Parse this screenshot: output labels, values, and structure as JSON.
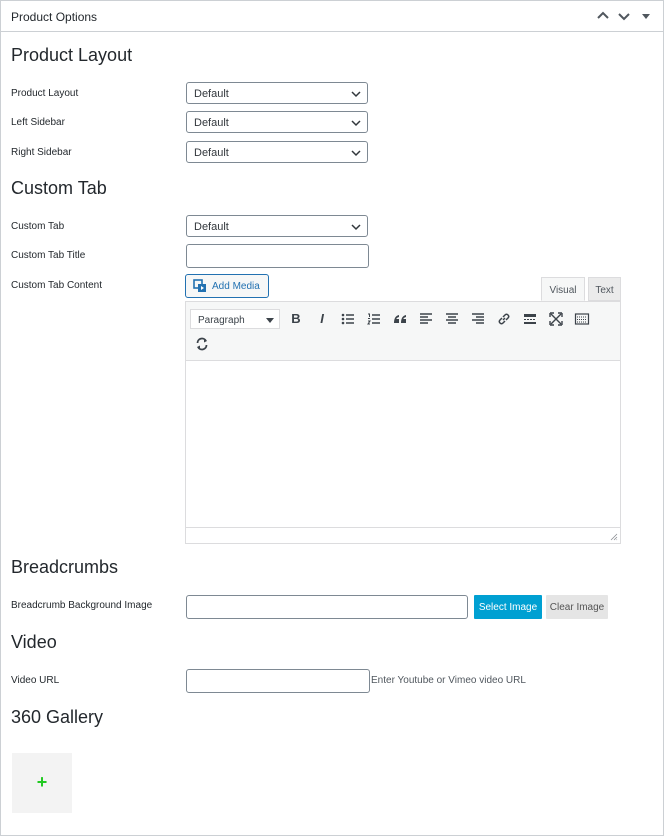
{
  "panel": {
    "title": "Product Options",
    "collapse_up_icon": "chevron-up-icon",
    "collapse_down_icon": "chevron-down-icon",
    "toggle_icon": "triangle-down-icon"
  },
  "product_layout": {
    "heading": "Product Layout",
    "fields": [
      {
        "label": "Product Layout",
        "value": "Default"
      },
      {
        "label": "Left Sidebar",
        "value": "Default"
      },
      {
        "label": "Right Sidebar",
        "value": "Default"
      }
    ]
  },
  "custom_tab": {
    "heading": "Custom Tab",
    "tab_label": "Custom Tab",
    "tab_value": "Default",
    "title_label": "Custom Tab Title",
    "title_value": "",
    "content_label": "Custom Tab Content",
    "add_media_label": "Add Media",
    "tabs": {
      "visual": "Visual",
      "text": "Text"
    },
    "format_value": "Paragraph",
    "toolbar_icons": [
      "bold-icon",
      "italic-icon",
      "bulleted-list-icon",
      "numbered-list-icon",
      "blockquote-icon",
      "align-left-icon",
      "align-center-icon",
      "align-right-icon",
      "link-icon",
      "read-more-icon",
      "fullscreen-icon",
      "toolbar-toggle-icon",
      "refresh-icon"
    ],
    "bold_glyph": "B",
    "italic_glyph": "I"
  },
  "breadcrumbs": {
    "heading": "Breadcrumbs",
    "image_label": "Breadcrumb Background Image",
    "image_value": "",
    "select_button": "Select Image",
    "clear_button": "Clear Image"
  },
  "video": {
    "heading": "Video",
    "url_label": "Video URL",
    "url_value": "",
    "hint": "Enter Youtube or Vimeo video URL"
  },
  "gallery": {
    "heading": "360 Gallery",
    "add_glyph": "+",
    "add_color": "#22c922"
  },
  "colors": {
    "primary_button": "#00a0d2",
    "link_blue": "#2271b1",
    "border": "#ccd0d4"
  }
}
